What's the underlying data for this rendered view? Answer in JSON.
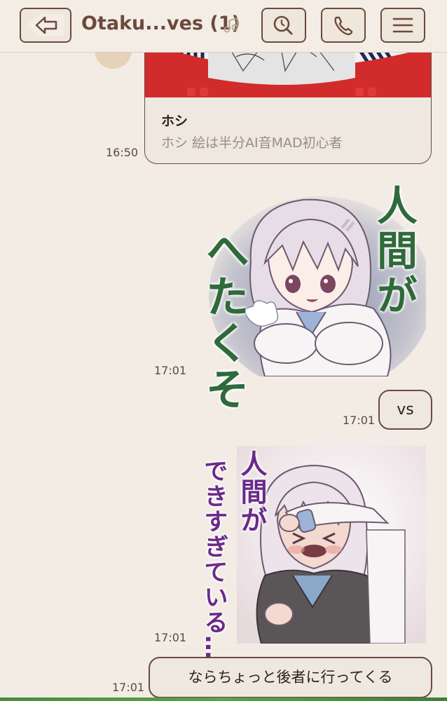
{
  "header": {
    "title": "Otaku...ves (1)",
    "icons": {
      "back": "back-arrow-icon",
      "note": "music-note-icon",
      "search": "search-icon",
      "call": "phone-icon",
      "menu": "menu-icon"
    }
  },
  "messages": {
    "link_card": {
      "title": "ホシ",
      "description": "ホシ 絵は半分AI音MAD初心者",
      "time": "16:50"
    },
    "sticker1": {
      "time": "17:01",
      "text_left": "へたくそ",
      "text_right": "人間が"
    },
    "text_vs": {
      "text": "vs",
      "time": "17:01"
    },
    "sticker2": {
      "time": "17:01",
      "text_top": "人間が",
      "text_bottom": "できすぎている…"
    },
    "text_last": {
      "text": "ならちょっと後者に行ってくる",
      "time": "17:01"
    }
  },
  "colors": {
    "background": "#f2ece5",
    "accent": "#6b4a3c",
    "bubble": "#efe8e0",
    "sticker1_text": "#2f6a3a",
    "sticker2_text": "#6a2a8a"
  }
}
